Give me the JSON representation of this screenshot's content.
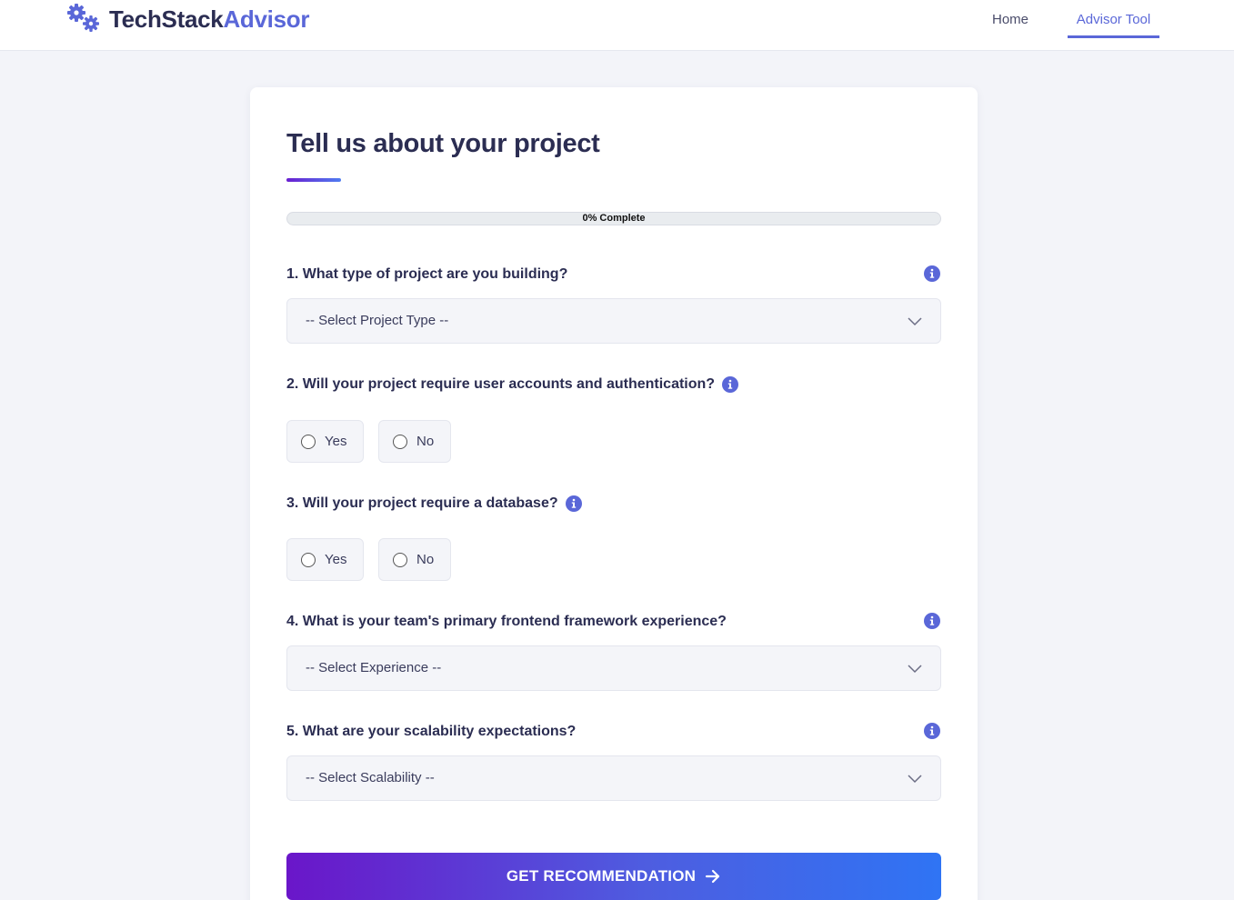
{
  "nav": {
    "brand_part1": "TechStack",
    "brand_part2": "Advisor",
    "brand_icon": "gears-icon",
    "links": [
      {
        "label": "Home",
        "active": false
      },
      {
        "label": "Advisor Tool",
        "active": true
      }
    ]
  },
  "form": {
    "title": "Tell us about your project",
    "progress": {
      "label": "0% Complete",
      "percent": 0
    },
    "questions": [
      {
        "label": "1. What type of project are you building?",
        "type": "select",
        "placeholder": "-- Select Project Type --"
      },
      {
        "label": "2. Will your project require user accounts and authentication?",
        "type": "radio",
        "options": [
          "Yes",
          "No"
        ]
      },
      {
        "label": "3. Will your project require a database?",
        "type": "radio",
        "options": [
          "Yes",
          "No"
        ]
      },
      {
        "label": "4. What is your team's primary frontend framework experience?",
        "type": "select",
        "placeholder": "-- Select Experience --"
      },
      {
        "label": "5. What are your scalability expectations?",
        "type": "select",
        "placeholder": "-- Select Scalability --"
      }
    ],
    "submit_label": "GET RECOMMENDATION",
    "submit_icon": "arrow-right-icon"
  },
  "colors": {
    "accent": "#5a67d8",
    "text_dark": "#2b2d52",
    "page_bg": "#f3f4f9",
    "cta_gradient_start": "#6a16c9",
    "cta_gradient_end": "#2f74f4"
  }
}
